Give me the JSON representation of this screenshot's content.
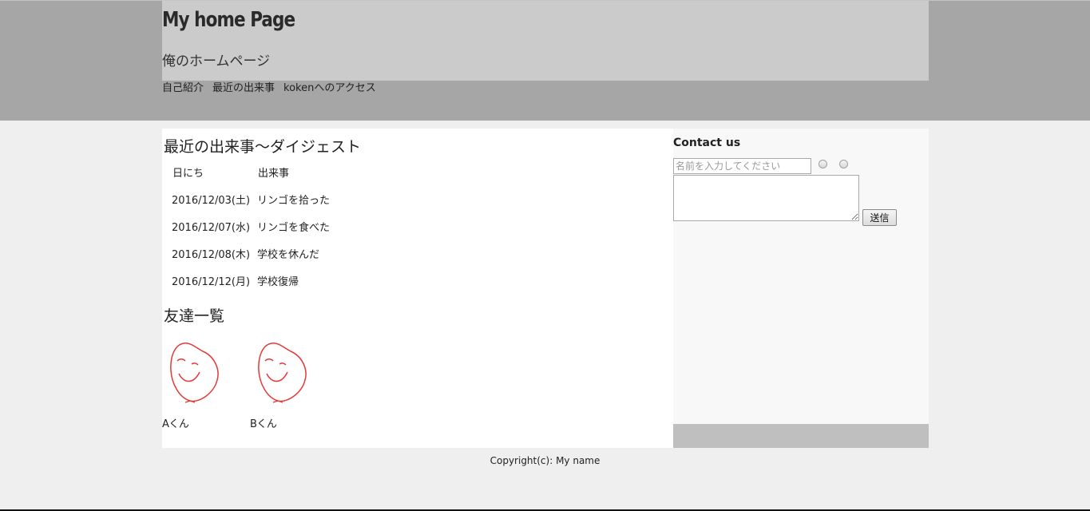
{
  "header": {
    "title": "My home Page",
    "subtitle": "俺のホームページ",
    "nav": [
      {
        "label": "自己紹介"
      },
      {
        "label": "最近の出来事"
      },
      {
        "label": "kokenへのアクセス"
      }
    ]
  },
  "events": {
    "title": "最近の出来事〜ダイジェスト",
    "headers": [
      "日にち",
      "出来事"
    ],
    "rows": [
      [
        "2016/12/03(土)",
        "リンゴを拾った"
      ],
      [
        "2016/12/07(水)",
        "リンゴを食べた"
      ],
      [
        "2016/12/08(木)",
        "学校を休んだ"
      ],
      [
        "2016/12/12(月)",
        "学校復帰"
      ]
    ]
  },
  "friends": {
    "title": "友達一覧",
    "items": [
      {
        "name": "Aくん",
        "icon": "smiley-face-drawing"
      },
      {
        "name": "Bくん",
        "icon": "smiley-face-drawing"
      }
    ]
  },
  "contact": {
    "title": "Contact us",
    "name_placeholder": "名前を入力してください",
    "name_value": "",
    "message_value": "",
    "send_label": "送信"
  },
  "footer": {
    "copyright": "Copyright(c): My name"
  },
  "colors": {
    "header_band": "#a6a6a6",
    "header_top": "#cbcbcb",
    "page_bg": "#efefef",
    "sidebar_bg": "#f8f8f8",
    "sidebar_bottom": "#bfbfbf",
    "face_stroke": "#e53935"
  }
}
